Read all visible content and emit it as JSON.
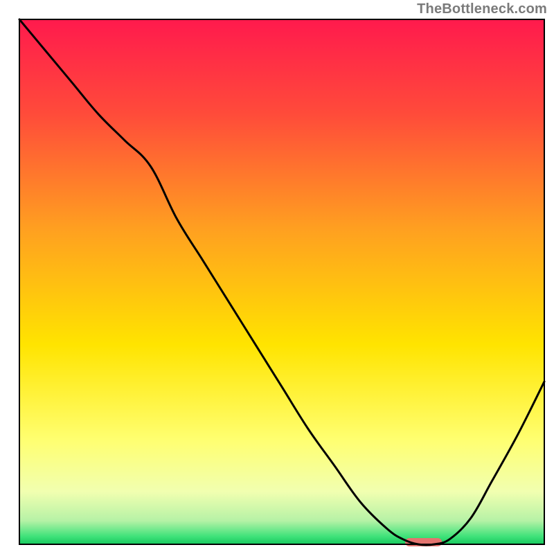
{
  "watermark": "TheBottleneck.com",
  "colors": {
    "gradient_top": "#ff1a4d",
    "gradient_mid1": "#ff6a2a",
    "gradient_mid2": "#ffd400",
    "gradient_mid3": "#ffff66",
    "gradient_bottom_y": "#f6ffb5",
    "gradient_green_light": "#9cf5a0",
    "gradient_green": "#1ed56a",
    "curve": "#000000",
    "marker": "#e4746f",
    "frame": "#000000"
  },
  "chart_data": {
    "type": "line",
    "title": "",
    "xlabel": "",
    "ylabel": "",
    "xlim": [
      0,
      100
    ],
    "ylim": [
      0,
      100
    ],
    "grid": false,
    "legend": false,
    "series": [
      {
        "name": "bottleneck-curve",
        "x": [
          0,
          5,
          10,
          15,
          20,
          25,
          30,
          35,
          40,
          45,
          50,
          55,
          60,
          65,
          70,
          73,
          76,
          79,
          82,
          86,
          90,
          95,
          100
        ],
        "y": [
          100,
          94,
          88,
          82,
          77,
          72,
          62,
          54,
          46,
          38,
          30,
          22,
          15,
          8,
          3,
          1,
          0,
          0,
          1,
          5,
          12,
          21,
          31
        ]
      }
    ],
    "annotations": [
      {
        "name": "optimal-marker",
        "shape": "rounded-bar",
        "x_range": [
          73.5,
          80.5
        ],
        "y": 0.4,
        "color": "#e4746f"
      }
    ],
    "background_gradient": {
      "direction": "top-to-bottom",
      "stops": [
        {
          "offset": 0.0,
          "color": "#ff1a4d"
        },
        {
          "offset": 0.18,
          "color": "#ff4b3a"
        },
        {
          "offset": 0.4,
          "color": "#ffa020"
        },
        {
          "offset": 0.62,
          "color": "#ffe400"
        },
        {
          "offset": 0.8,
          "color": "#ffff70"
        },
        {
          "offset": 0.9,
          "color": "#f1ffb0"
        },
        {
          "offset": 0.955,
          "color": "#b6f2a6"
        },
        {
          "offset": 0.985,
          "color": "#3fe27a"
        },
        {
          "offset": 1.0,
          "color": "#17c85d"
        }
      ]
    }
  }
}
